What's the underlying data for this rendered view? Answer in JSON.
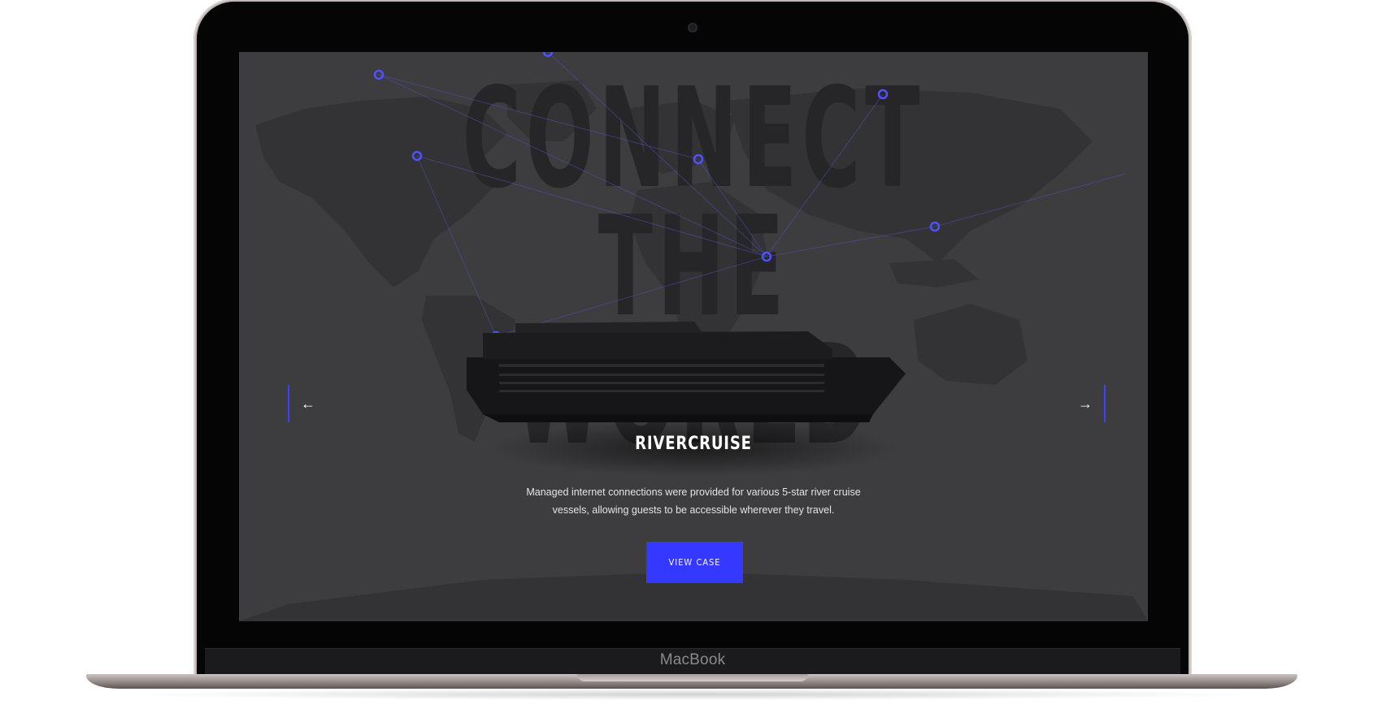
{
  "device": {
    "brand_label": "MacBook"
  },
  "hero": {
    "headline_line1": "CONNECT",
    "headline_line2": "THE WORLD"
  },
  "slider": {
    "prev_label": "←",
    "next_label": "→",
    "slide": {
      "title": "RIVERCRUISE",
      "description": "Managed internet connections were provided for various 5-star river cruise vessels, allowing guests to be accessible wherever they travel.",
      "cta_label": "VIEW CASE"
    }
  },
  "colors": {
    "accent": "#3538ff",
    "node": "#4f52ff",
    "screen_bg": "#3d3d3f",
    "map_land": "#2e2e30",
    "headline": "#262628"
  },
  "icons": {
    "prev": "arrow-left-icon",
    "next": "arrow-right-icon"
  }
}
